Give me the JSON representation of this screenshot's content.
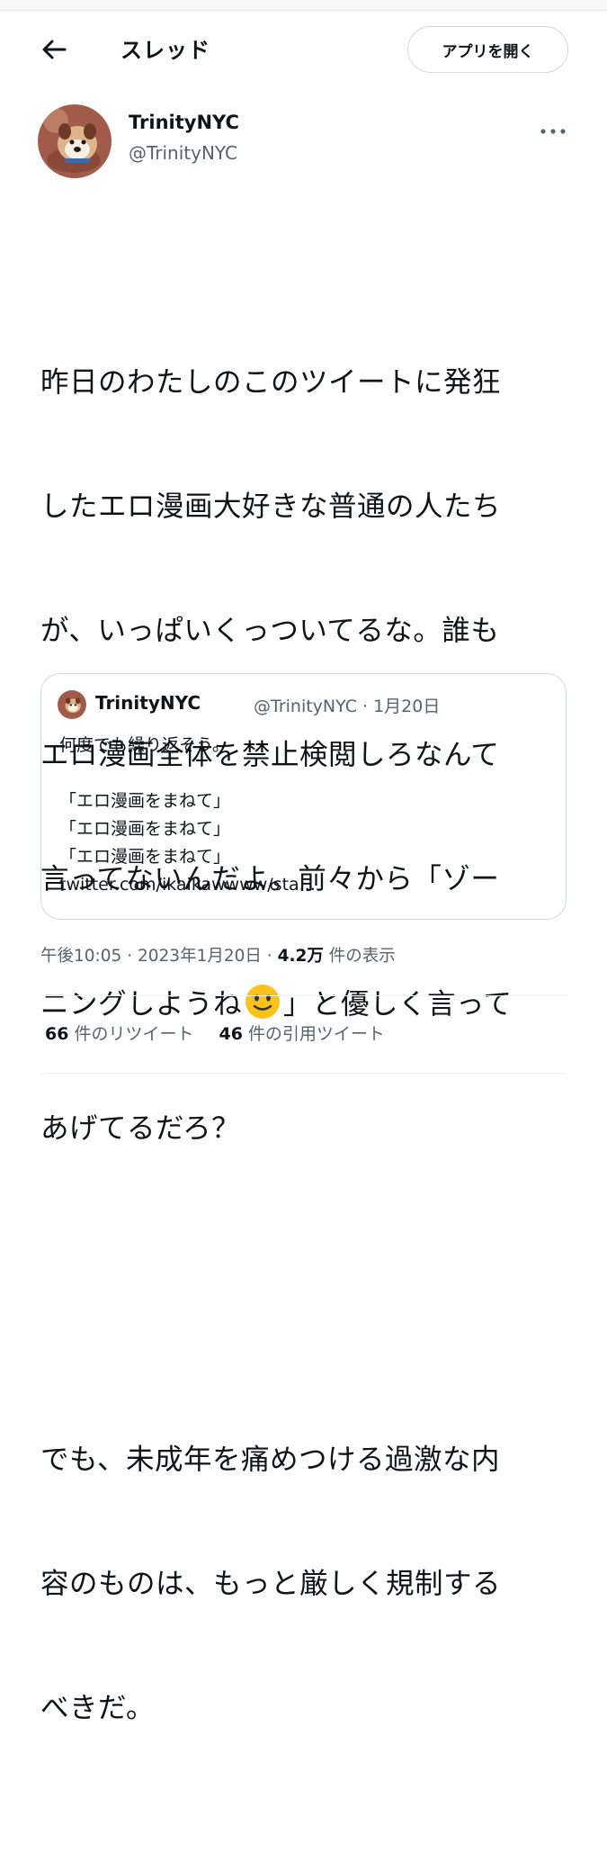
{
  "header": {
    "title": "スレッド",
    "open_app_label": "アプリを開く"
  },
  "tweet": {
    "author_name": "TrinityNYC",
    "author_handle": "@TrinityNYC",
    "paragraphs": {
      "p1_lines": [
        "昨日のわたしのこのツイートに発狂",
        "したエロ漫画大好きな普通の人たち",
        "が、いっぱいくっついてるな。誰も",
        "エロ漫画全体を禁止検閲しろなんて",
        "言ってないんだよ。前々から「ゾー",
        "ニングしようね",
        "」と優しく言って",
        "あげてるだろ？"
      ],
      "p2_lines": [
        "でも、未成年を痛めつける過激な内",
        "容のものは、もっと厳しく規制する",
        "べきだ。"
      ]
    },
    "emoji": "slightly-smiling-face-icon"
  },
  "quoted_tweet": {
    "author_name": "TrinityNYC",
    "author_handle": "@TrinityNYC",
    "date": "· 1月20日",
    "lines": [
      "何度でも繰り返そう。",
      "",
      "「エロ漫画をまねて」",
      "「エロ漫画をまねて」",
      "「エロ漫画をまねて」",
      "twitter.com/ikaikawwww/sta..."
    ]
  },
  "meta": {
    "time": "午後10:05",
    "separator": "·",
    "date": "2023年1月20日",
    "views_count": "4.2万",
    "views_label": "件の表示"
  },
  "stats": {
    "retweets_count": "66",
    "retweets_label": "件のリツイート",
    "quotes_count": "46",
    "quotes_label": "件の引用ツイート"
  },
  "colors": {
    "text": "#0f1419",
    "secondary": "#536471",
    "border": "#cfd9de"
  }
}
